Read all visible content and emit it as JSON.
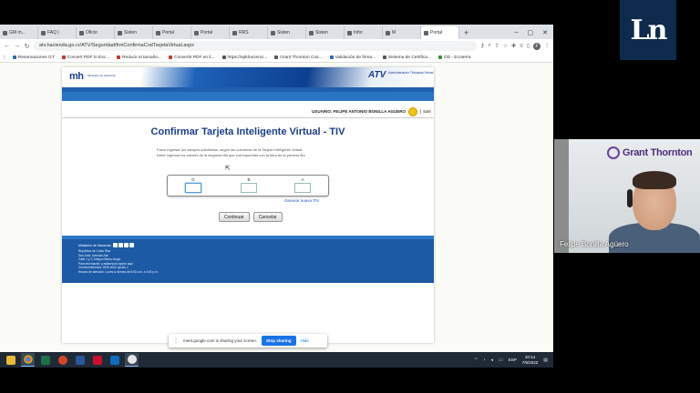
{
  "browser": {
    "tabs": [
      {
        "label": "GM m..."
      },
      {
        "label": "FAQ |"
      },
      {
        "label": "Oficio"
      },
      {
        "label": "Sisten"
      },
      {
        "label": "Portal"
      },
      {
        "label": "Portal"
      },
      {
        "label": "RRS"
      },
      {
        "label": "Sisten"
      },
      {
        "label": "Sisten"
      },
      {
        "label": "Infor"
      },
      {
        "label": "M"
      },
      {
        "label": "Portal"
      }
    ],
    "url": "atv.hacienda.go.cr/ATV/Seguridad/frmConfirmaCodTarjetaVirtual.aspx",
    "profile_initial": "F",
    "bookmarks": [
      {
        "label": "Reservaciones GT"
      },
      {
        "label": "Convert PDF to Exc..."
      },
      {
        "label": "Reducir el tamaño..."
      },
      {
        "label": "Convertir PDF en li..."
      },
      {
        "label": "https://apkhacienci..."
      },
      {
        "label": "Grant Thornton Cos..."
      },
      {
        "label": "Validación de firma..."
      },
      {
        "label": "Sistema de Certifica..."
      },
      {
        "label": "OD - Ecoterra"
      }
    ]
  },
  "atv": {
    "ministry_logo": "mh",
    "ministry_logo_sub": "Ministerio de Hacienda",
    "atv_logo": "ATV",
    "atv_logo_sub": "Administración Tributaria Virtual",
    "user_label": "USUARIO: FELIPE ANTONIO BONILLA AGUERO",
    "exit_label": "Salir",
    "title": "Confirmar Tarjeta Inteligente Virtual - TIV",
    "instructions_1": "Favor ingresar los campos solicitados, según las columnas de la Tarjeta Inteligente Virtual.",
    "instructions_2": "Debe ingresar los valores de la segunda fila que correspondan con la letra de la primera fila",
    "coords": [
      {
        "letter": "G",
        "value": ""
      },
      {
        "letter": "B",
        "value": ""
      },
      {
        "letter": "A",
        "value": ""
      }
    ],
    "generate_link": "Generar nueva TIV",
    "continue_label": "Continuar",
    "cancel_label": "Cancelar",
    "footer": {
      "ministry": "Ministerio de Hacienda",
      "lines": [
        "República de Costa Rica",
        "San José, Avenida 2da",
        "Calle 1 y 3, Antiguo Banco Anglo",
        "Para información y asistencia ingrese aquí",
        "Central telefónica: 2539-4000 opción 1",
        "Horario de atención: Lunes a viernes de 8:00 a.m. a 4:00 p.m."
      ]
    }
  },
  "share_bar": {
    "message": "meet.google.com is sharing your screen.",
    "stop_label": "Stop sharing",
    "hide_label": "Hide"
  },
  "taskbar": {
    "language": "ESP",
    "time": "10:14",
    "date": "7/6/2022"
  },
  "right_panel": {
    "logo_text": "Ln",
    "brand_text": "Grant Thornton",
    "participant_name": "Felipe Bonilla Agüero"
  }
}
